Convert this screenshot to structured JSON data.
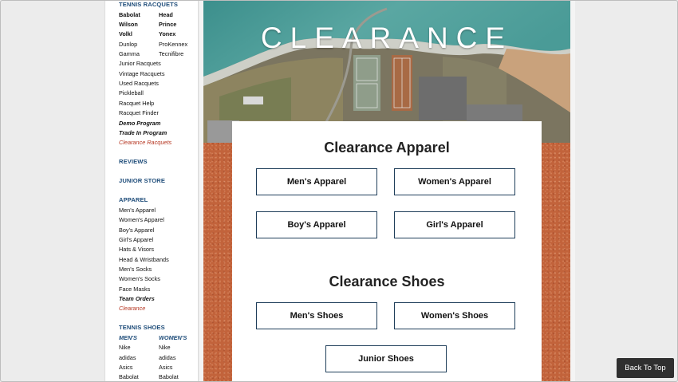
{
  "sidebar": {
    "tennis_racquets": {
      "title": "TENNIS RACQUETS",
      "brands_left": [
        "Babolat",
        "Wilson",
        "Volkl",
        "Dunlop",
        "Gamma"
      ],
      "brands_right": [
        "Head",
        "Prince",
        "Yonex",
        "ProKennex",
        "Tecnifibre"
      ],
      "links": [
        "Junior Racquets",
        "Vintage Racquets",
        "Used Racquets",
        "Pickleball",
        "Racquet Help",
        "Racquet Finder"
      ],
      "demo": "Demo Program",
      "trade_in": "Trade In Program",
      "clearance": "Clearance Racquets"
    },
    "reviews": "REVIEWS",
    "junior_store": "JUNIOR STORE",
    "apparel": {
      "title": "APPAREL",
      "links": [
        "Men's Apparel",
        "Women's Apparel",
        "Boy's Apparel",
        "Girl's Apparel",
        "Hats & Visors",
        "Head & Wristbands",
        "Men's Socks",
        "Women's Socks",
        "Face Masks"
      ],
      "team_orders": "Team Orders",
      "clearance": "Clearance"
    },
    "tennis_shoes": {
      "title": "TENNIS SHOES",
      "mens_label": "MEN'S",
      "womens_label": "WOMEN'S",
      "mens": [
        "Nike",
        "adidas",
        "Asics",
        "Babolat"
      ],
      "womens": [
        "Nike",
        "adidas",
        "Asics",
        "Babolat"
      ]
    }
  },
  "hero": {
    "title": "CLEARANCE"
  },
  "clearance_apparel": {
    "heading": "Clearance Apparel",
    "buttons": [
      "Men's Apparel",
      "Women's Apparel",
      "Boy's Apparel",
      "Girl's Apparel"
    ]
  },
  "clearance_shoes": {
    "heading": "Clearance Shoes",
    "buttons": [
      "Men's Shoes",
      "Women's Shoes",
      "Junior Shoes"
    ]
  },
  "back_to_top": "Back To Top",
  "colors": {
    "nav_blue": "#1f4d7a",
    "clearance_red": "#b5341f",
    "button_border": "#1f3e5a",
    "clay": "#c2633b"
  }
}
